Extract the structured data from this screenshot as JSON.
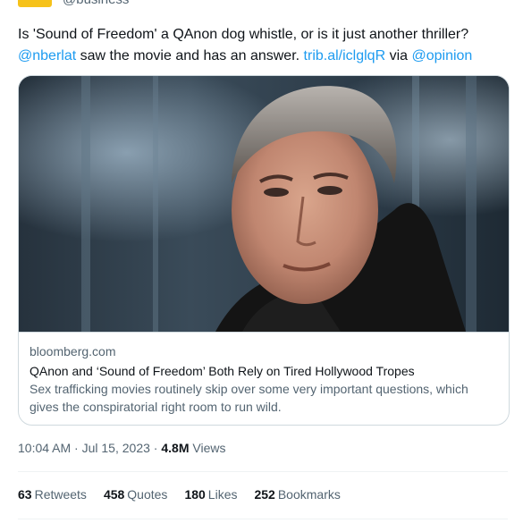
{
  "author": {
    "handle": "@business"
  },
  "tweet": {
    "text_plain": "Is 'Sound of Freedom' a QAnon dog whistle, or is it just another thriller?",
    "mention": "@nberlat",
    "text_mid": " saw the movie and has an answer. ",
    "url": "trib.al/iclglqR",
    "text_via": " via ",
    "via_mention": "@opinion"
  },
  "card": {
    "domain": "bloomberg.com",
    "title": "QAnon and ‘Sound of Freedom’ Both Rely on Tired Hollywood Tropes",
    "description": "Sex trafficking movies routinely skip over some very important questions, which gives the conspiratorial right room to run wild."
  },
  "meta": {
    "time": "10:04 AM",
    "sep1": " · ",
    "date": "Jul 15, 2023",
    "sep2": " · ",
    "views_count": "4.8M",
    "views_label": " Views"
  },
  "stats": {
    "retweets_count": "63",
    "retweets_label": "Retweets",
    "quotes_count": "458",
    "quotes_label": "Quotes",
    "likes_count": "180",
    "likes_label": "Likes",
    "bookmarks_count": "252",
    "bookmarks_label": "Bookmarks"
  },
  "colors": {
    "link": "#1d9bf0",
    "muted": "#536471",
    "text": "#0f1419",
    "border": "#cfd9de"
  }
}
